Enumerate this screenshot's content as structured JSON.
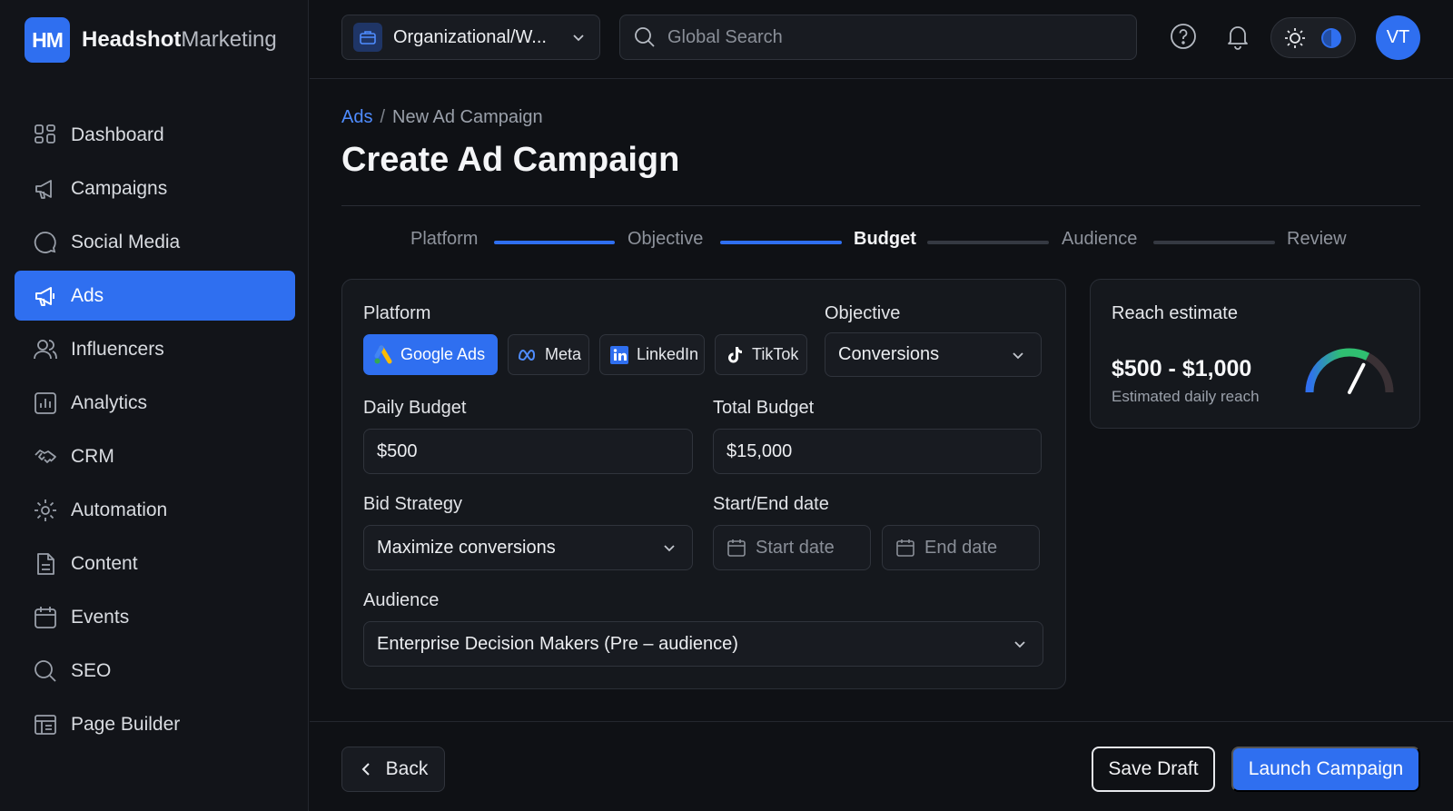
{
  "brand": {
    "logo": "HM",
    "name_bold": "Headshot",
    "name_light": "Marketing"
  },
  "sidebar": {
    "items": [
      {
        "label": "Dashboard",
        "icon": "grid-icon"
      },
      {
        "label": "Campaigns",
        "icon": "megaphone-icon"
      },
      {
        "label": "Social Media",
        "icon": "chat-bubble-icon"
      },
      {
        "label": "Ads",
        "icon": "megaphone-icon",
        "active": true
      },
      {
        "label": "Influencers",
        "icon": "users-icon"
      },
      {
        "label": "Analytics",
        "icon": "bar-chart-icon"
      },
      {
        "label": "CRM",
        "icon": "handshake-icon"
      },
      {
        "label": "Automation",
        "icon": "gear-icon"
      },
      {
        "label": "Content",
        "icon": "document-icon"
      },
      {
        "label": "Events",
        "icon": "calendar-icon"
      },
      {
        "label": "SEO",
        "icon": "search-icon"
      },
      {
        "label": "Page Builder",
        "icon": "layout-icon"
      }
    ]
  },
  "topbar": {
    "org_label": "Organizational/W...",
    "search_placeholder": "Global Search",
    "avatar_initials": "VT"
  },
  "breadcrumb": {
    "parent": "Ads",
    "separator": "/",
    "current": "New Ad Campaign"
  },
  "page_title": "Create Ad Campaign",
  "stepper": {
    "steps": [
      "Platform",
      "Objective",
      "Budget",
      "Audience",
      "Review"
    ],
    "current_index": 2
  },
  "form": {
    "platform_label": "Platform",
    "platforms": [
      {
        "label": "Google Ads",
        "icon": "google-ads-icon",
        "selected": true
      },
      {
        "label": "Meta",
        "icon": "meta-icon",
        "selected": false
      },
      {
        "label": "LinkedIn",
        "icon": "linkedin-icon",
        "selected": false
      },
      {
        "label": "TikTok",
        "icon": "tiktok-icon",
        "selected": false
      }
    ],
    "objective_label": "Objective",
    "objective_value": "Conversions",
    "daily_budget_label": "Daily Budget",
    "daily_budget_value": "$500",
    "total_budget_label": "Total Budget",
    "total_budget_value": "$15,000",
    "bid_strategy_label": "Bid Strategy",
    "bid_strategy_value": "Maximize conversions",
    "dates_label": "Start/End date",
    "start_date_placeholder": "Start date",
    "end_date_placeholder": "End date",
    "audience_label": "Audience",
    "audience_value": "Enterprise Decision Makers (Pre – audience)"
  },
  "reach": {
    "title": "Reach estimate",
    "value": "$500 - $1,000",
    "subtitle": "Estimated daily reach",
    "gauge_level": 0.65
  },
  "footer": {
    "back_label": "Back",
    "save_draft_label": "Save Draft",
    "launch_label": "Launch Campaign"
  },
  "colors": {
    "accent": "#2f6ff0",
    "link": "#4f8cff",
    "background": "#0f1115",
    "gauge_start": "#2f6ff0",
    "gauge_mid": "#2fbf71"
  }
}
